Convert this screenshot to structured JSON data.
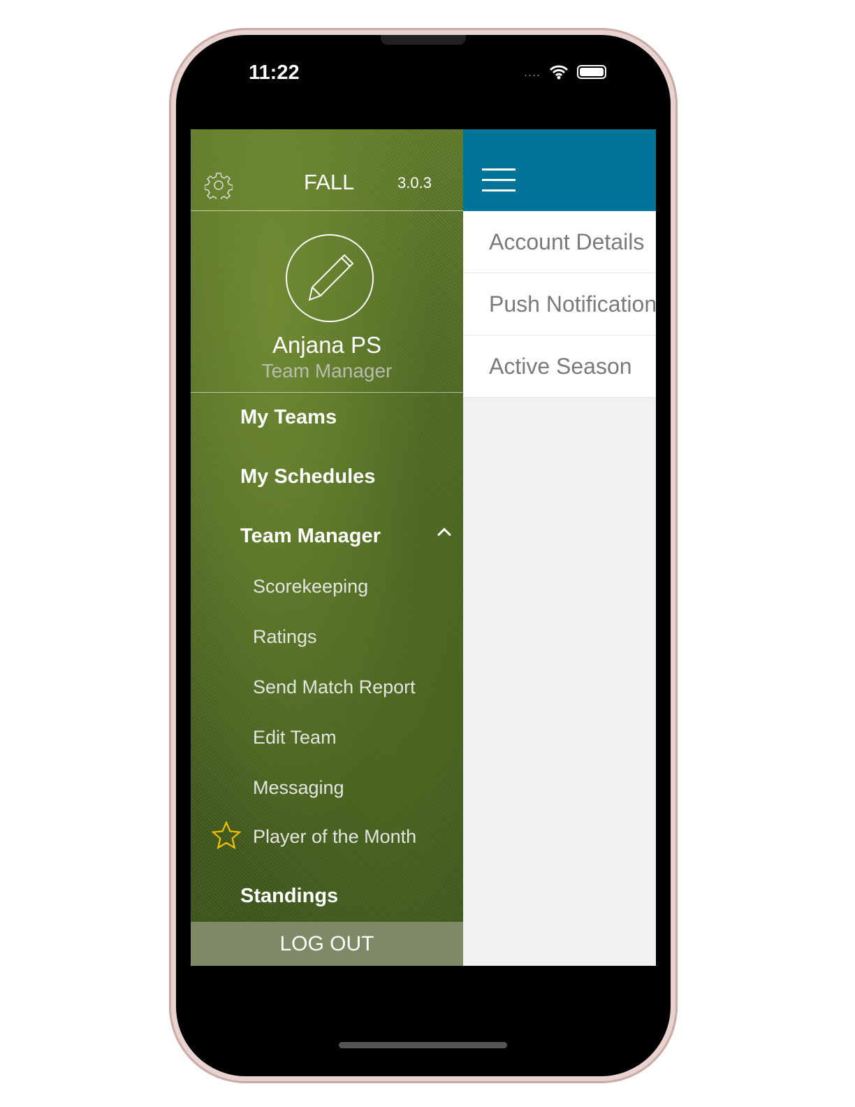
{
  "status_bar": {
    "time": "11:22",
    "signal": "....",
    "icons": [
      "wifi-icon",
      "battery-icon"
    ]
  },
  "drawer": {
    "season": "FALL",
    "version": "3.0.3",
    "user": {
      "name": "Anjana PS",
      "role": "Team Manager"
    },
    "items": [
      {
        "label": "My Teams"
      },
      {
        "label": "My Schedules"
      },
      {
        "label": "Team Manager",
        "expanded": true,
        "children": [
          "Scorekeeping",
          "Ratings",
          "Send Match Report",
          "Edit Team",
          "Messaging",
          "Player of the Month"
        ]
      },
      {
        "label": "Standings"
      }
    ],
    "logout": "LOG OUT",
    "star_color": "#f5c000"
  },
  "main": {
    "header_color": "#007399",
    "settings": [
      "Account Details",
      "Push Notifications",
      "Active Season"
    ]
  }
}
